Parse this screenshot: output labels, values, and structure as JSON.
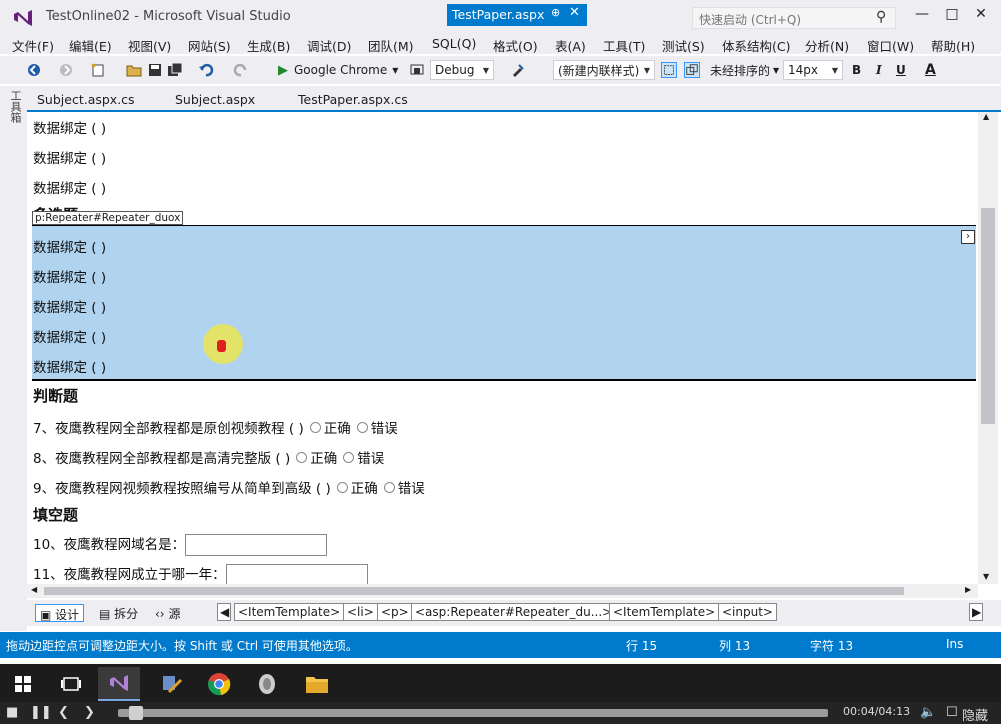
{
  "window": {
    "title": "TestOnline02 - Microsoft Visual Studio",
    "quick_launch_placeholder": "快速启动 (Ctrl+Q)"
  },
  "menu": [
    "文件(F)",
    "编辑(E)",
    "视图(V)",
    "网站(S)",
    "生成(B)",
    "调试(D)",
    "团队(M)",
    "SQL(Q)",
    "格式(O)",
    "表(A)",
    "工具(T)",
    "测试(S)",
    "体系结构(C)",
    "分析(N)",
    "窗口(W)",
    "帮助(H)"
  ],
  "toolbar": {
    "browser": "Google Chrome",
    "config": "Debug",
    "style_combo": "(新建内联样式)",
    "sort_combo": "未经排序的",
    "font_size": "14px",
    "bold": "B",
    "italic": "I",
    "underline": "U",
    "font_color": "A"
  },
  "toolbox_label": "工具箱",
  "tabs": [
    {
      "label": "Subject.aspx.cs"
    },
    {
      "label": "Subject.aspx"
    },
    {
      "label": "TestPaper.aspx.cs"
    },
    {
      "label": "TestPaper.aspx",
      "active": true
    }
  ],
  "editor": {
    "bound_top": [
      "数据绑定 ( )",
      "数据绑定 ( )",
      "数据绑定 ( )"
    ],
    "multi_heading": "多选题",
    "repeater_tag": "p:Repeater#Repeater_duox",
    "bound_selected": [
      "数据绑定 ( )",
      "数据绑定 ( )",
      "数据绑定 ( )",
      "数据绑定 ( )",
      "数据绑定 ( )"
    ],
    "judge_heading": "判断题",
    "judge_questions": [
      "7、夜鹰教程网全部教程都是原创视频教程 ( )",
      "8、夜鹰教程网全部教程都是高清完整版 ( )",
      "9、夜鹰教程网视频教程按照编号从简单到高级 ( )"
    ],
    "true_label": "正确",
    "false_label": "错误",
    "fill_heading": "填空题",
    "fill_questions": [
      "10、夜鹰教程网域名是：",
      "11、夜鹰教程网成立于哪一年："
    ]
  },
  "viewbar": {
    "design": "设计",
    "split": "拆分",
    "source": "源"
  },
  "breadcrumbs": [
    "<ItemTemplate>",
    "<li>",
    "<p>",
    "<asp:Repeater#Repeater_du...>",
    "<ItemTemplate>",
    "<input>"
  ],
  "status": {
    "message": "拖动边距控点可调整边距大小。按 Shift 或 Ctrl 可使用其他选项。",
    "row": "行 15",
    "col": "列 13",
    "char": "字符 13",
    "ins": "Ins"
  },
  "media": {
    "time": "00:04/04:13",
    "hide": "隐藏",
    "progress": 0.016
  },
  "colors": {
    "accent": "#007acc",
    "selection": "#b0d4f0",
    "chrome": "#eeeef2"
  }
}
